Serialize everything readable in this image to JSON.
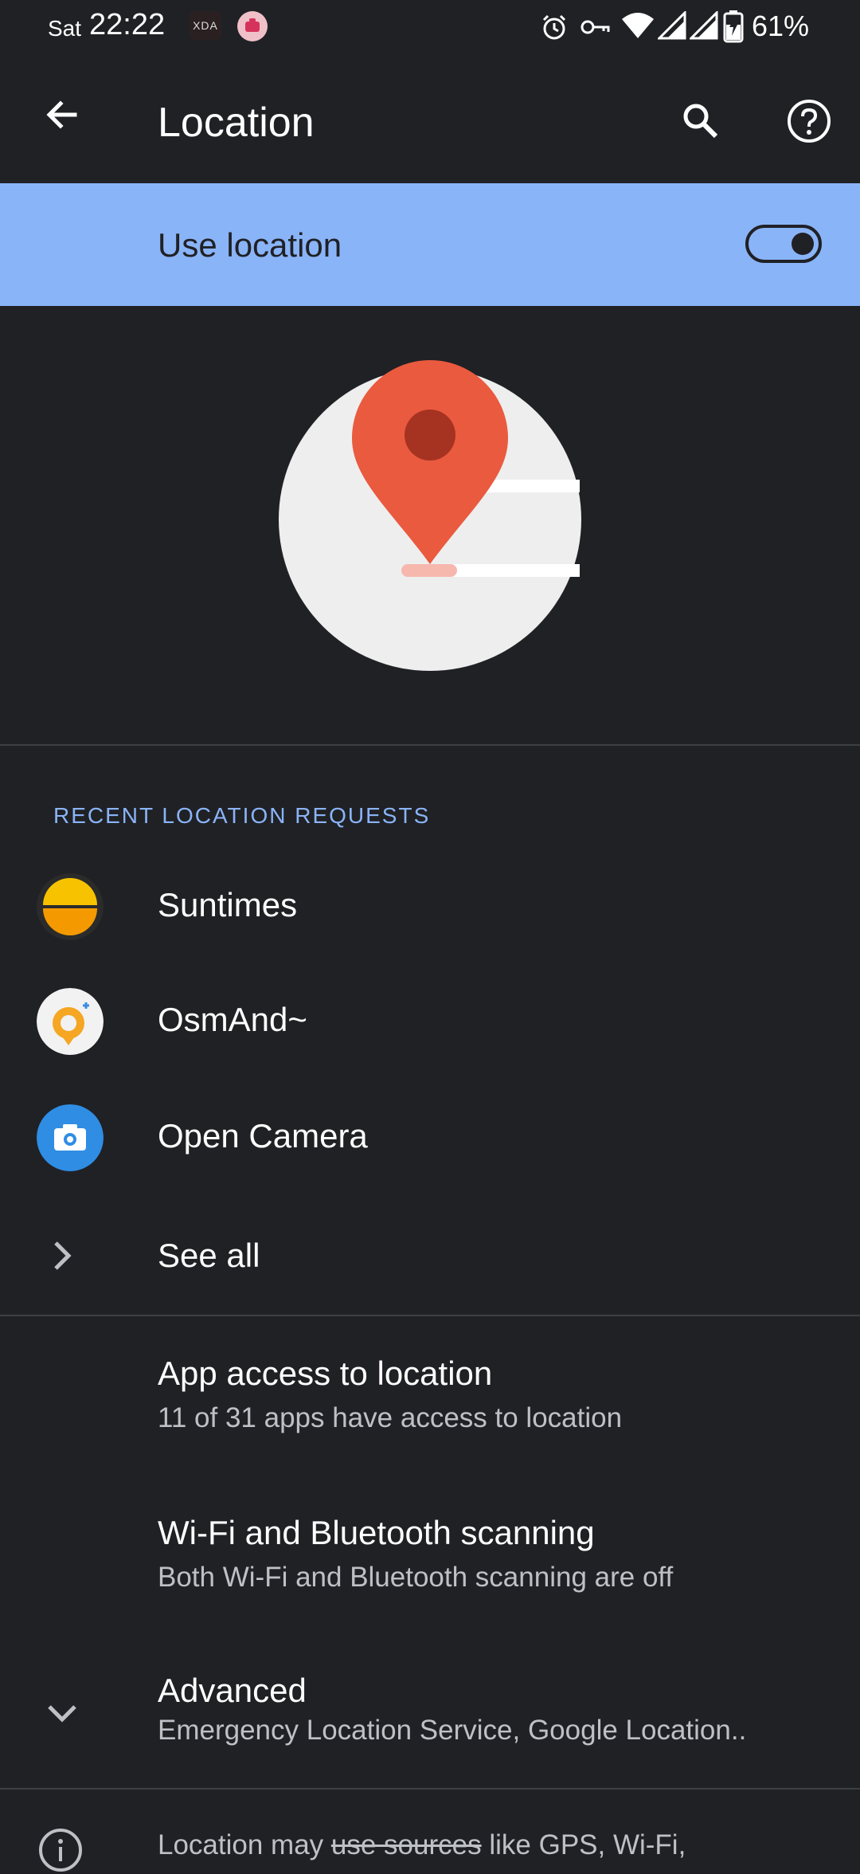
{
  "status_bar": {
    "day": "Sat",
    "time": "22:22",
    "notification_icons": [
      "xda-icon",
      "app-notification-icon"
    ],
    "right_icons": [
      "alarm-icon",
      "vpn-key-icon",
      "wifi-icon",
      "signal-icon",
      "signal-icon",
      "battery-charging-icon"
    ],
    "battery_percent": "61%",
    "xda_text": "XDA"
  },
  "app_bar": {
    "title": "Location",
    "icons": [
      "back-arrow-icon",
      "search-icon",
      "help-icon"
    ]
  },
  "use_location": {
    "label": "Use location",
    "enabled": true
  },
  "recent": {
    "header": "RECENT LOCATION REQUESTS",
    "apps": [
      {
        "name": "Suntimes",
        "icon": "suntimes-icon"
      },
      {
        "name": "OsmAnd~",
        "icon": "osmand-icon"
      },
      {
        "name": "Open Camera",
        "icon": "camera-icon"
      }
    ],
    "see_all": "See all"
  },
  "prefs": [
    {
      "title": "App access to location",
      "subtitle": "11 of 31 apps have access to location"
    },
    {
      "title": "Wi-Fi and Bluetooth scanning",
      "subtitle": "Both Wi-Fi and Bluetooth scanning are off"
    },
    {
      "title": "Advanced",
      "subtitle": "Emergency Location Service, Google Location.."
    }
  ],
  "footer": {
    "text_before": "Location may ",
    "text_strike": "use sources",
    "text_after": " like GPS, Wi-Fi,"
  },
  "colors": {
    "background": "#202125",
    "accent": "#8ab4f8",
    "pin": "#ea5a3f",
    "pin_dark": "#a63321",
    "globe": "#eeeeee"
  }
}
